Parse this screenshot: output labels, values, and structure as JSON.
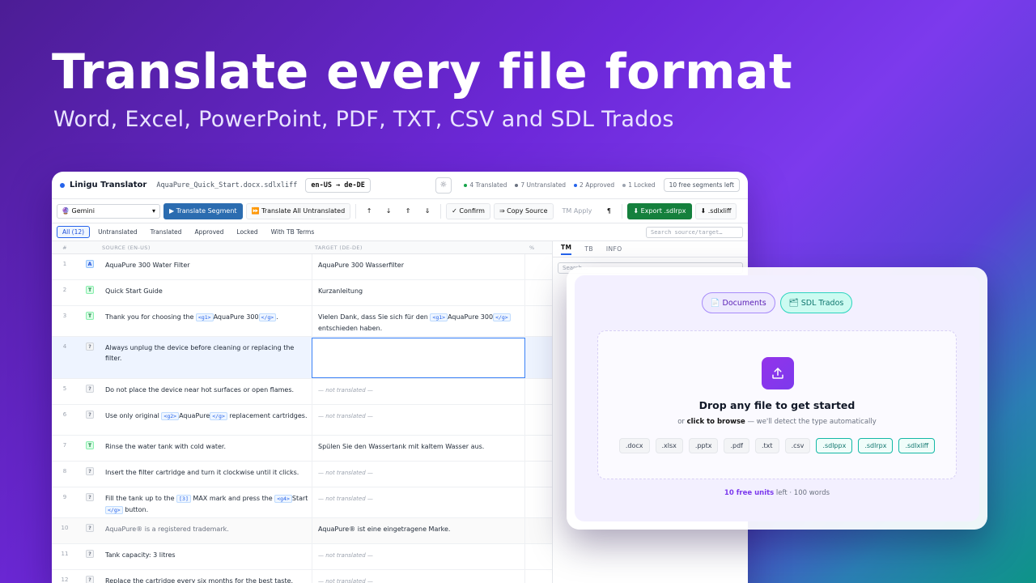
{
  "hero": {
    "title": "Translate every file format",
    "subtitle": "Word, Excel, PowerPoint, PDF, TXT, CSV and SDL Trados"
  },
  "app": {
    "brand": "Linigu Translator",
    "filename": "AquaPure_Quick_Start.docx.sdlxliff",
    "lang_pair": "en-US → de-DE",
    "theme_icon": "☼",
    "stats": {
      "translated": "4 Translated",
      "untranslated": "7 Untranslated",
      "approved": "2 Approved",
      "locked": "1 Locked",
      "free": "10 free segments left"
    },
    "colors": {
      "translated": "#16a34a",
      "untranslated": "#6b7280",
      "approved": "#2563eb",
      "locked": "#9ca3af"
    },
    "toolbar": {
      "engine": "🔮 Gemini",
      "engine_caret": "▾",
      "translate_segment": "▶ Translate Segment",
      "translate_all": "⏩ Translate All Untranslated",
      "arrows": [
        "↑",
        "↓",
        "⇑",
        "⇓"
      ],
      "confirm": "✓ Confirm",
      "copy_source": "⇒ Copy Source",
      "tm_apply": "TM Apply",
      "pilcrow": "¶",
      "export": "⬇ Export .sdlrpx",
      "sdlxliff": "⬇ .sdlxliff"
    },
    "filters": [
      "All (12)",
      "Untranslated",
      "Translated",
      "Approved",
      "Locked",
      "With TB Terms"
    ],
    "search_placeholder": "Search source/target…",
    "columns": {
      "num": "#",
      "source": "SOURCE (EN-US)",
      "target": "TARGET (DE-DE)",
      "pct": "%"
    },
    "side_tabs": [
      "TM",
      "TB",
      "INFO"
    ],
    "side_search": "Search…"
  },
  "segments": [
    {
      "n": "1",
      "status": "A",
      "src": [
        "AquaPure 300 Water Filter"
      ],
      "tgt": [
        "AquaPure 300 Wasserfilter"
      ]
    },
    {
      "n": "2",
      "status": "T",
      "src": [
        "Quick Start Guide"
      ],
      "tgt": [
        "Kurzanleitung"
      ]
    },
    {
      "n": "3",
      "status": "T",
      "src": [
        "Thank you for choosing the ",
        "<g1>",
        "AquaPure 300",
        "</g>",
        "."
      ],
      "tgt": [
        "Vielen Dank, dass Sie sich für den ",
        "<g1>",
        "AquaPure 300",
        "</g>",
        " entschieden haben."
      ]
    },
    {
      "n": "4",
      "status": "?",
      "src": [
        "Always unplug the device before cleaning or replacing the filter."
      ],
      "tgt": []
    },
    {
      "n": "5",
      "status": "?",
      "src": [
        "Do not place the device near hot surfaces or open flames."
      ],
      "tgt": "— not translated —"
    },
    {
      "n": "6",
      "status": "?",
      "src": [
        "Use only original ",
        "<g2>",
        "AquaPure",
        "</g>",
        " replacement cartridges."
      ],
      "tgt": "— not translated —"
    },
    {
      "n": "7",
      "status": "T",
      "src": [
        "Rinse the water tank with cold water."
      ],
      "tgt": [
        "Spülen Sie den Wassertank mit kaltem Wasser aus."
      ]
    },
    {
      "n": "8",
      "status": "?",
      "src": [
        "Insert the filter cartridge and turn it clockwise until it clicks."
      ],
      "tgt": "— not translated —"
    },
    {
      "n": "9",
      "status": "?",
      "src": [
        "Fill the tank up to the ",
        "[3]",
        " MAX mark and press the ",
        "<g4>",
        "Start ",
        "</g>",
        " button."
      ],
      "tgt": "— not translated —"
    },
    {
      "n": "10",
      "status": "?",
      "src": [
        "AquaPure® is a registered trademark."
      ],
      "tgt": [
        "AquaPure® ist eine eingetragene Marke."
      ]
    },
    {
      "n": "11",
      "status": "?",
      "src": [
        "Tank capacity: 3 litres"
      ],
      "tgt": "— not translated —"
    },
    {
      "n": "12",
      "status": "?",
      "src": [
        "Replace the cartridge every six months for the best taste."
      ],
      "tgt": "— not translated —"
    }
  ],
  "upload": {
    "tab_documents": "📄 Documents",
    "tab_sdl": "🗂 SDL Trados",
    "upload_icon": "upload-icon",
    "drop_title": "Drop any file to get started",
    "drop_or": "or ",
    "drop_browse": "click to browse",
    "drop_rest": " — we'll detect the type automatically",
    "exts": [
      ".docx",
      ".xlsx",
      ".pptx",
      ".pdf",
      ".txt",
      ".csv"
    ],
    "sdl_exts": [
      ".sdlppx",
      ".sdlrpx",
      ".sdlxliff"
    ],
    "units_bold": "10 free units",
    "units_rest": " left · 100 words"
  }
}
